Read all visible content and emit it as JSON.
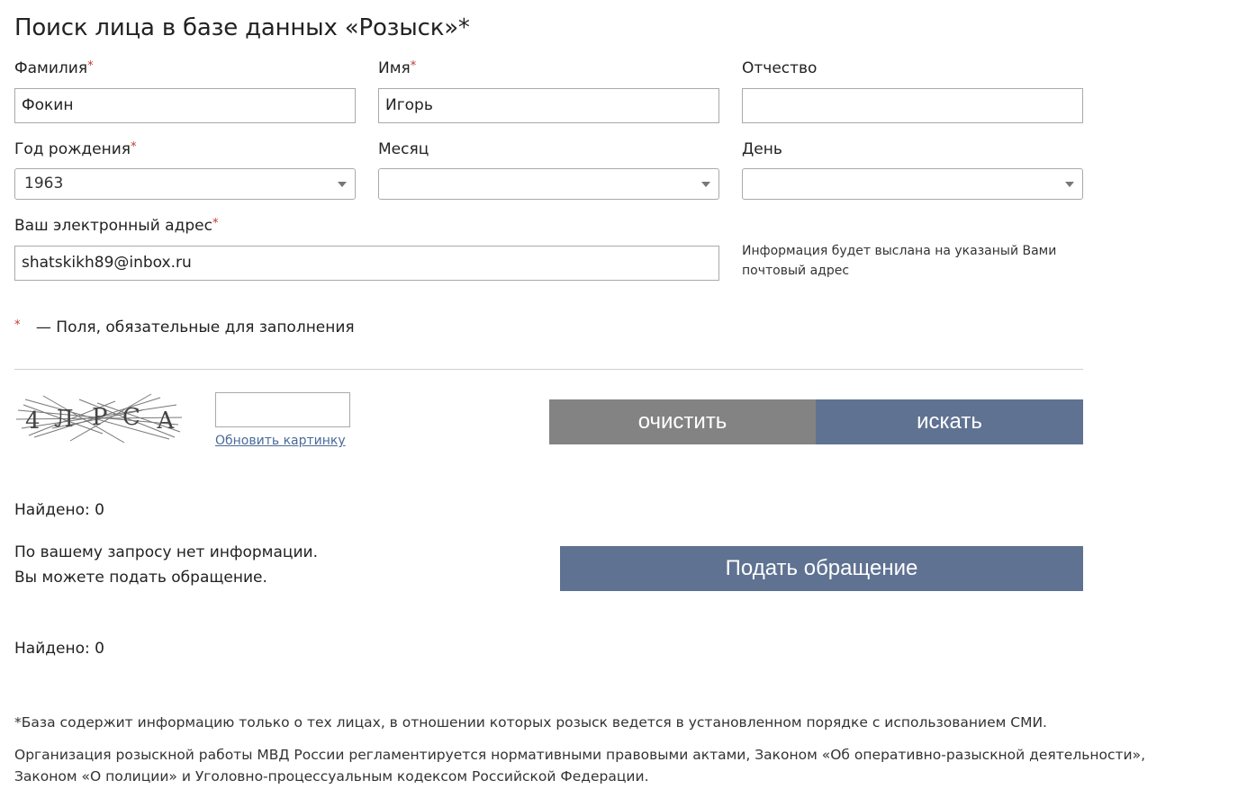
{
  "page_title": "Поиск лица в базе данных «Розыск»*",
  "form": {
    "required_mark": "*",
    "surname": {
      "label": "Фамилия",
      "value": "Фокин"
    },
    "name": {
      "label": "Имя",
      "value": "Игорь"
    },
    "patronymic": {
      "label": "Отчество",
      "value": ""
    },
    "birth_year": {
      "label": "Год рождения",
      "value": "1963"
    },
    "month": {
      "label": "Месяц",
      "value": ""
    },
    "day": {
      "label": "День",
      "value": ""
    },
    "email": {
      "label": "Ваш электронный адрес",
      "value": "shatskikh89@inbox.ru"
    },
    "email_hint": "Информация будет выслана на указаный Вами почтовый адрес",
    "required_note": "— Поля, обязательные для заполнения"
  },
  "captcha": {
    "letters": [
      "4",
      "Л",
      "Р",
      "С",
      "А"
    ],
    "input_value": "",
    "refresh_link": "Обновить картинку"
  },
  "buttons": {
    "clear": "очистить",
    "search": "искать",
    "submit_appeal": "Подать обращение"
  },
  "results": {
    "found_1": "Найдено: 0",
    "no_info_line1": "По вашему запросу нет информации.",
    "no_info_line2": "Вы можете подать обращение.",
    "found_2": "Найдено: 0"
  },
  "footer": {
    "note1": "*База содержит информацию только о тех лицах, в отношении которых розыск ведется в установленном порядке с использованием СМИ.",
    "note2_line1": "Организация розыскной работы МВД России регламентируется нормативными правовыми актами, Законом «Об оперативно-разыскной деятельности»,",
    "note2_line2": "Законом «О полиции» и Уголовно-процессуальным кодексом Российской Федерации."
  },
  "colors": {
    "clear_button": "#838383",
    "search_button": "#5f7292",
    "appeal_button": "#5f7292",
    "required": "#c0392b",
    "link": "#4a6a9a"
  }
}
